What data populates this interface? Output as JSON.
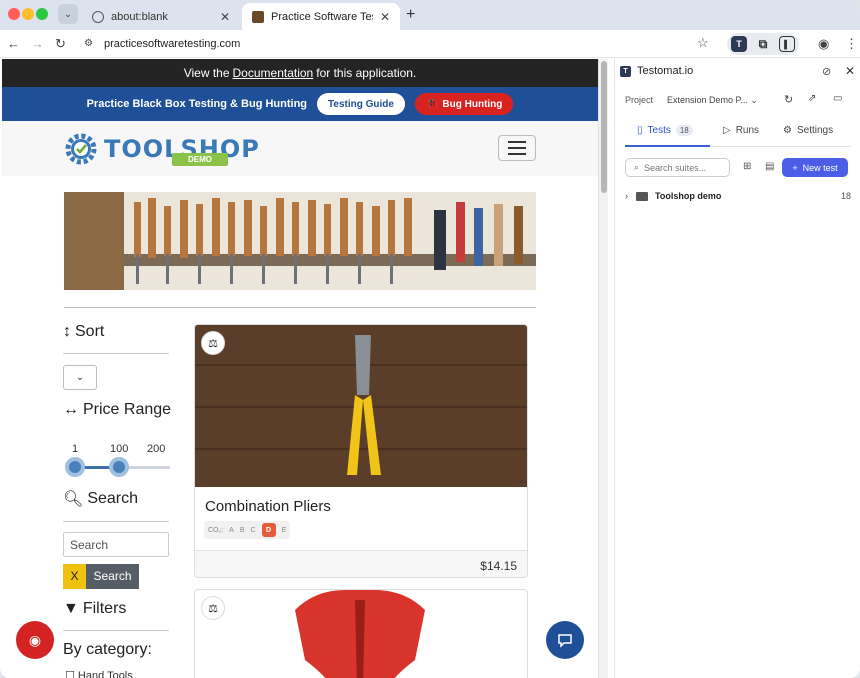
{
  "browser": {
    "tabs": [
      {
        "title": "about:blank",
        "active": false
      },
      {
        "title": "Practice Software Testing - To",
        "active": true
      }
    ],
    "url": "practicesoftwaretesting.com"
  },
  "page": {
    "doc_bar": {
      "prefix": "View the",
      "link": "Documentation",
      "suffix": "for this application."
    },
    "promo": {
      "label": "Practice Black Box Testing & Bug Hunting",
      "guide_button": "Testing Guide",
      "bug_button": "Bug Hunting"
    },
    "logo": {
      "text": "TOOLSHOP",
      "tag": "DEMO"
    },
    "sidebar": {
      "sort_title": "Sort",
      "price_title": "Price Range",
      "price_min": "1",
      "price_value": "100",
      "price_max": "200",
      "search_title": "Search",
      "search_placeholder": "Search",
      "clear_label": "X",
      "search_button": "Search",
      "filters_title": "Filters",
      "category_title": "By category:",
      "first_category": "Hand Tools"
    },
    "products": [
      {
        "name": "Combination Pliers",
        "price": "$14.15",
        "eco_label": "CO₂:",
        "eco_grades": [
          "A",
          "B",
          "C",
          "D",
          "E"
        ],
        "eco_active": "D"
      }
    ]
  },
  "panel": {
    "title": "Testomat.io",
    "project_label": "Project",
    "project_value": "Extension Demo P...",
    "tabs": {
      "tests": "Tests",
      "tests_count": "18",
      "runs": "Runs",
      "settings": "Settings"
    },
    "search_placeholder": "Search suites...",
    "new_test": "New test",
    "suite": {
      "name": "Toolshop demo",
      "count": "18"
    }
  },
  "colors": {
    "accent_blue": "#1f4f96",
    "bug_red": "#d92321",
    "panel_accent": "#4c5ee8"
  }
}
